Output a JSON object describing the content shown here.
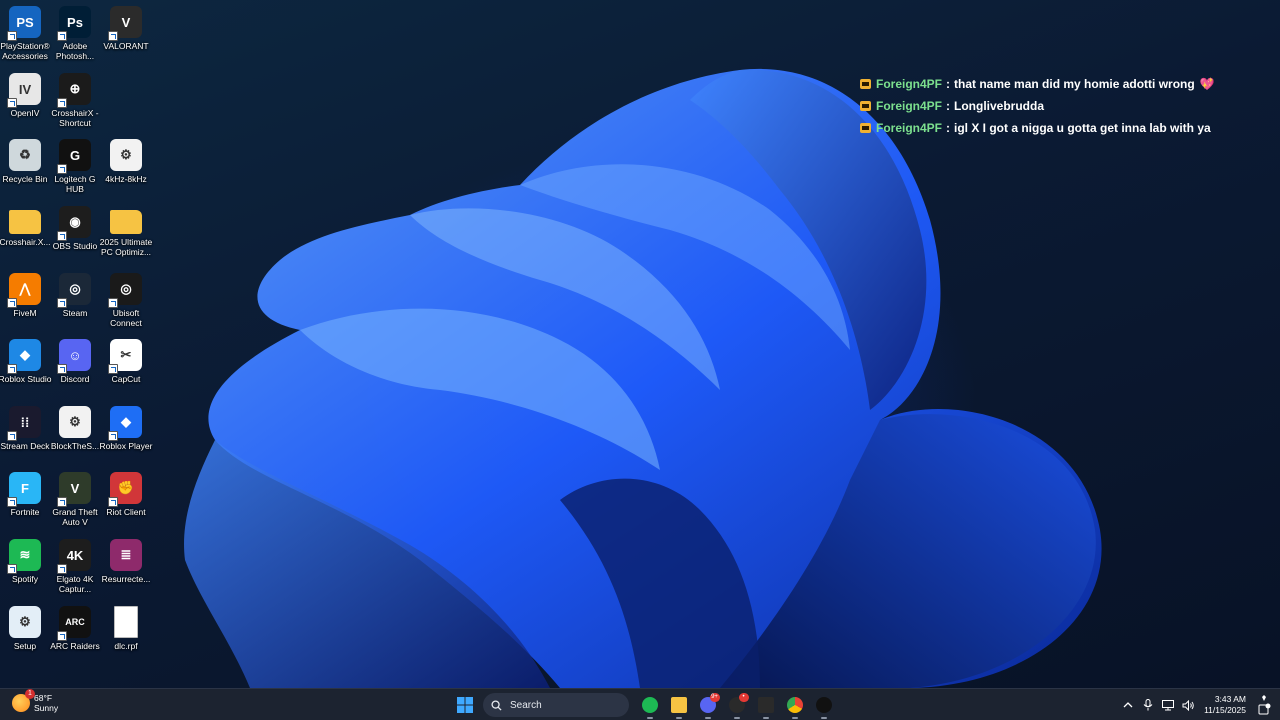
{
  "desktop_icons": [
    {
      "label": "PlayStation® Accessories",
      "icon": "playstation-icon",
      "color": "#1565c0",
      "glyph": "PS",
      "shortcut": true
    },
    {
      "label": "Adobe Photosh...",
      "icon": "photoshop-icon",
      "color": "#001e36",
      "glyph": "Ps",
      "shortcut": true
    },
    {
      "label": "VALORANT",
      "icon": "valorant-icon",
      "color": "#2b2b2b",
      "glyph": "V",
      "shortcut": true
    },
    {
      "label": "OpenIV",
      "icon": "openiv-icon",
      "color": "#e7e7e7",
      "glyph": "IV",
      "shortcut": true
    },
    {
      "label": "CrosshairX - Shortcut",
      "icon": "crosshairx-icon",
      "color": "#1b1b1b",
      "glyph": "⊕",
      "shortcut": true
    },
    {
      "label": "Recycle Bin",
      "icon": "recycle-bin-icon",
      "color": "#cfd8dc",
      "glyph": "♻",
      "shortcut": false
    },
    {
      "label": "Logitech G HUB",
      "icon": "logitech-ghub-icon",
      "color": "#111111",
      "glyph": "G",
      "shortcut": true
    },
    {
      "label": "4kHz-8kHz",
      "icon": "settings-file-icon",
      "color": "#f2f2f2",
      "glyph": "⚙",
      "shortcut": false
    },
    {
      "label": "Crosshair.X...",
      "icon": "folder-icon",
      "color": "#f6c343",
      "glyph": "",
      "shortcut": false
    },
    {
      "label": "OBS Studio",
      "icon": "obs-studio-icon",
      "color": "#1d1d1d",
      "glyph": "◉",
      "shortcut": true
    },
    {
      "label": "2025 Ultimate PC Optimiz...",
      "icon": "folder-icon",
      "color": "#f6c343",
      "glyph": "",
      "shortcut": false
    },
    {
      "label": "FiveM",
      "icon": "fivem-icon",
      "color": "#f57c00",
      "glyph": "⋀",
      "shortcut": true
    },
    {
      "label": "Steam",
      "icon": "steam-icon",
      "color": "#1b2838",
      "glyph": "◎",
      "shortcut": true
    },
    {
      "label": "Ubisoft Connect",
      "icon": "ubisoft-icon",
      "color": "#1a1a1a",
      "glyph": "◎",
      "shortcut": true
    },
    {
      "label": "Roblox Studio",
      "icon": "roblox-studio-icon",
      "color": "#1e88e5",
      "glyph": "◆",
      "shortcut": true
    },
    {
      "label": "Discord",
      "icon": "discord-icon",
      "color": "#5865f2",
      "glyph": "☺",
      "shortcut": true
    },
    {
      "label": "CapCut",
      "icon": "capcut-icon",
      "color": "#ffffff",
      "glyph": "✂",
      "shortcut": true
    },
    {
      "label": "Stream Deck",
      "icon": "stream-deck-icon",
      "color": "#1a1a2e",
      "glyph": "⁞⁞",
      "shortcut": true
    },
    {
      "label": "BlockTheS...",
      "icon": "settings-file-icon",
      "color": "#f2f2f2",
      "glyph": "⚙",
      "shortcut": false
    },
    {
      "label": "Roblox Player",
      "icon": "roblox-player-icon",
      "color": "#1e6ef5",
      "glyph": "◆",
      "shortcut": true
    },
    {
      "label": "Fortnite",
      "icon": "fortnite-icon",
      "color": "#29b6f6",
      "glyph": "F",
      "shortcut": true
    },
    {
      "label": "Grand Theft Auto V",
      "icon": "gta-v-icon",
      "color": "#2e3b2a",
      "glyph": "V",
      "shortcut": true
    },
    {
      "label": "Riot Client",
      "icon": "riot-client-icon",
      "color": "#d13639",
      "glyph": "✊",
      "shortcut": true
    },
    {
      "label": "Spotify",
      "icon": "spotify-icon",
      "color": "#1db954",
      "glyph": "≋",
      "shortcut": true
    },
    {
      "label": "Elgato 4K Captur...",
      "icon": "elgato-4k-icon",
      "color": "#1d1d1d",
      "glyph": "4K",
      "shortcut": true
    },
    {
      "label": "Resurrecte...",
      "icon": "winrar-icon",
      "color": "#8e2a6b",
      "glyph": "≣",
      "shortcut": false
    },
    {
      "label": "Setup",
      "icon": "setup-icon",
      "color": "#e3eef7",
      "glyph": "⚙",
      "shortcut": false
    },
    {
      "label": "ARC Raiders",
      "icon": "arc-raiders-icon",
      "color": "#111111",
      "glyph": "ARC",
      "shortcut": true
    },
    {
      "label": "dlc.rpf",
      "icon": "file-icon",
      "color": "#ffffff",
      "glyph": "",
      "shortcut": false
    }
  ],
  "chat": [
    {
      "user": "Foreign4PF",
      "message": "that name man did my homie adotti wrong",
      "heart": "💖"
    },
    {
      "user": "Foreign4PF",
      "message": "Longlivebrudda",
      "heart": ""
    },
    {
      "user": "Foreign4PF",
      "message": "igl X I got a nigga u gotta get inna lab with ya",
      "heart": ""
    }
  ],
  "chat_separator": ":",
  "taskbar": {
    "weather": {
      "temp": "68°F",
      "condition": "Sunny",
      "badge": "1"
    },
    "search_placeholder": "Search",
    "pinned": [
      {
        "name": "spotify",
        "icon": "spotify-icon",
        "color": "#1db954",
        "running": true,
        "badge": ""
      },
      {
        "name": "file-explorer",
        "icon": "folder-icon",
        "color": "#f6c343",
        "running": true,
        "badge": ""
      },
      {
        "name": "discord",
        "icon": "discord-icon",
        "color": "#5865f2",
        "running": true,
        "badge": "9+"
      },
      {
        "name": "obs-studio",
        "icon": "obs-studio-icon",
        "color": "#2a2a2a",
        "running": true,
        "badge": "•"
      },
      {
        "name": "epic-games",
        "icon": "epic-games-icon",
        "color": "#2a2a2a",
        "running": true,
        "badge": ""
      },
      {
        "name": "chrome",
        "icon": "chrome-icon",
        "color": "#4285f4",
        "running": true,
        "badge": ""
      },
      {
        "name": "logitech-ghub",
        "icon": "logitech-ghub-icon",
        "color": "#111111",
        "running": true,
        "badge": ""
      }
    ],
    "clock": {
      "time": "3:43 AM",
      "date": "11/15/2025"
    }
  },
  "colors": {
    "chat_user": "#7ce08e",
    "taskbar_bg": "#1c2330",
    "accent": "#1f6bff"
  }
}
